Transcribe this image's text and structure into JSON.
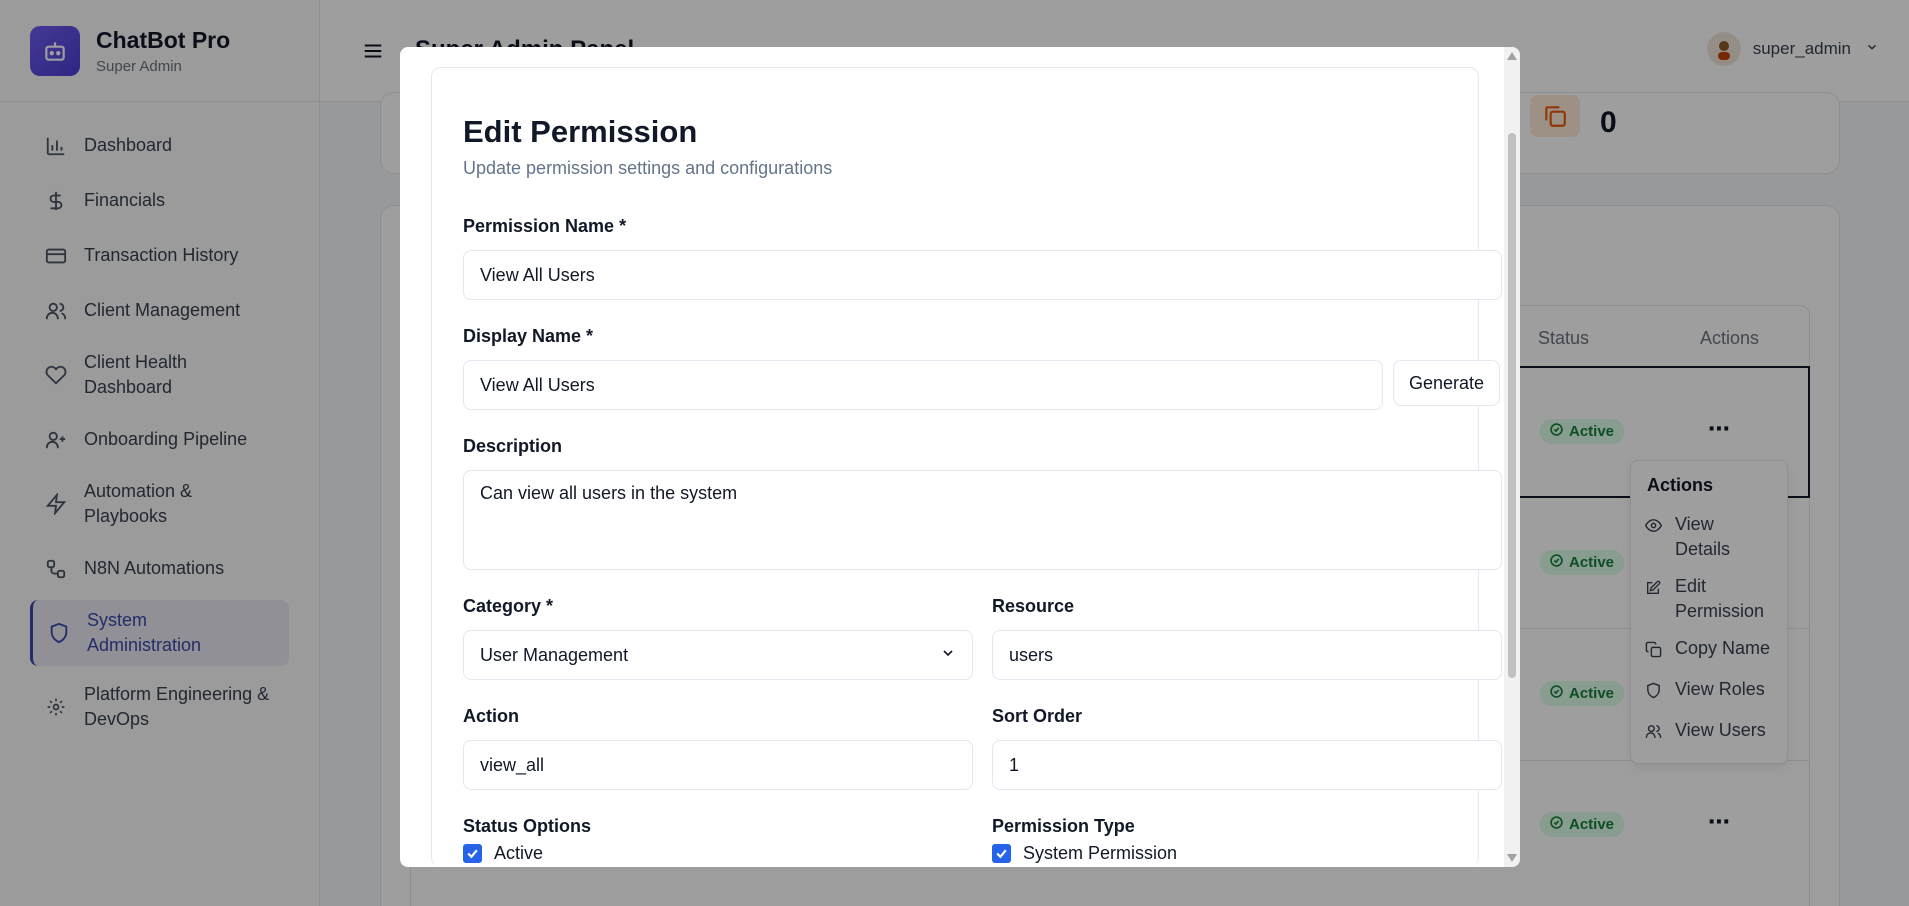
{
  "app": {
    "name": "ChatBot Pro",
    "role": "Super Admin"
  },
  "sidebar": {
    "items": [
      {
        "label": "Dashboard",
        "icon": "bar-chart-icon"
      },
      {
        "label": "Financials",
        "icon": "dollar-icon"
      },
      {
        "label": "Transaction History",
        "icon": "credit-card-icon"
      },
      {
        "label": "Client Management",
        "icon": "users-icon"
      },
      {
        "label": "Client Health Dashboard",
        "icon": "heart-icon"
      },
      {
        "label": "Onboarding Pipeline",
        "icon": "user-plus-icon"
      },
      {
        "label": "Automation & Playbooks",
        "icon": "zap-icon"
      },
      {
        "label": "N8N Automations",
        "icon": "workflow-icon"
      },
      {
        "label": "System Administration",
        "icon": "shield-icon",
        "active": true
      },
      {
        "label": "Platform Engineering & DevOps",
        "icon": "gear-icon"
      }
    ]
  },
  "header": {
    "title": "Super Admin Panel",
    "username": "super_admin"
  },
  "background": {
    "stat_value": "0",
    "table_headers": {
      "status": "Status",
      "actions": "Actions"
    },
    "status_label": "Active",
    "context_menu": {
      "title": "Actions",
      "items": [
        "View Details",
        "Edit Permission",
        "Copy Name",
        "View Roles",
        "View Users"
      ]
    }
  },
  "modal": {
    "title": "Edit Permission",
    "subtitle": "Update permission settings and configurations",
    "permission_name_label": "Permission Name *",
    "permission_name_value": "View All Users",
    "display_name_label": "Display Name *",
    "display_name_value": "View All Users",
    "generate_label": "Generate",
    "description_label": "Description",
    "description_value": "Can view all users in the system",
    "category_label": "Category *",
    "category_value": "User Management",
    "resource_label": "Resource",
    "resource_value": "users",
    "action_label": "Action",
    "action_value": "view_all",
    "sort_order_label": "Sort Order",
    "sort_order_value": "1",
    "status_options_label": "Status Options",
    "status_active_label": "Active",
    "permission_type_label": "Permission Type",
    "system_permission_label": "System Permission"
  },
  "colors": {
    "accent": "#2563eb",
    "brand": "#5b4be8",
    "active_badge": "#15803d"
  }
}
